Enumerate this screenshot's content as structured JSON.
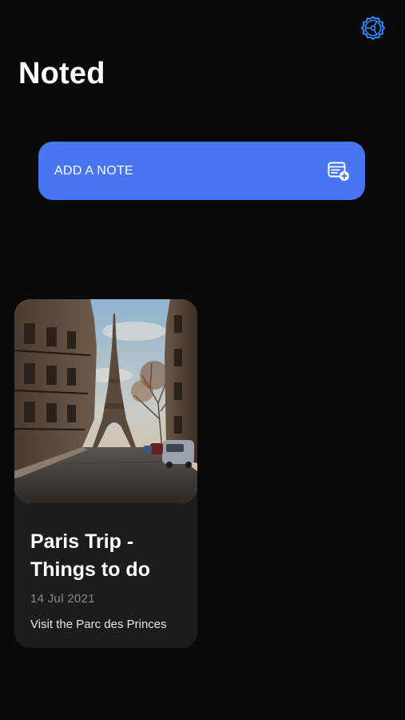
{
  "header": {
    "title": "Noted",
    "settings_icon": "gear-icon",
    "accent_color": "#2f8bff"
  },
  "add_note": {
    "label": "ADD A NOTE",
    "icon": "add-note-icon",
    "background_color": "#4876f3"
  },
  "notes": [
    {
      "title": "Paris Trip - Things to do",
      "date": "14 Jul 2021",
      "preview": "Visit the Parc des Princes",
      "image": "eiffel-tower-street-photo"
    }
  ]
}
